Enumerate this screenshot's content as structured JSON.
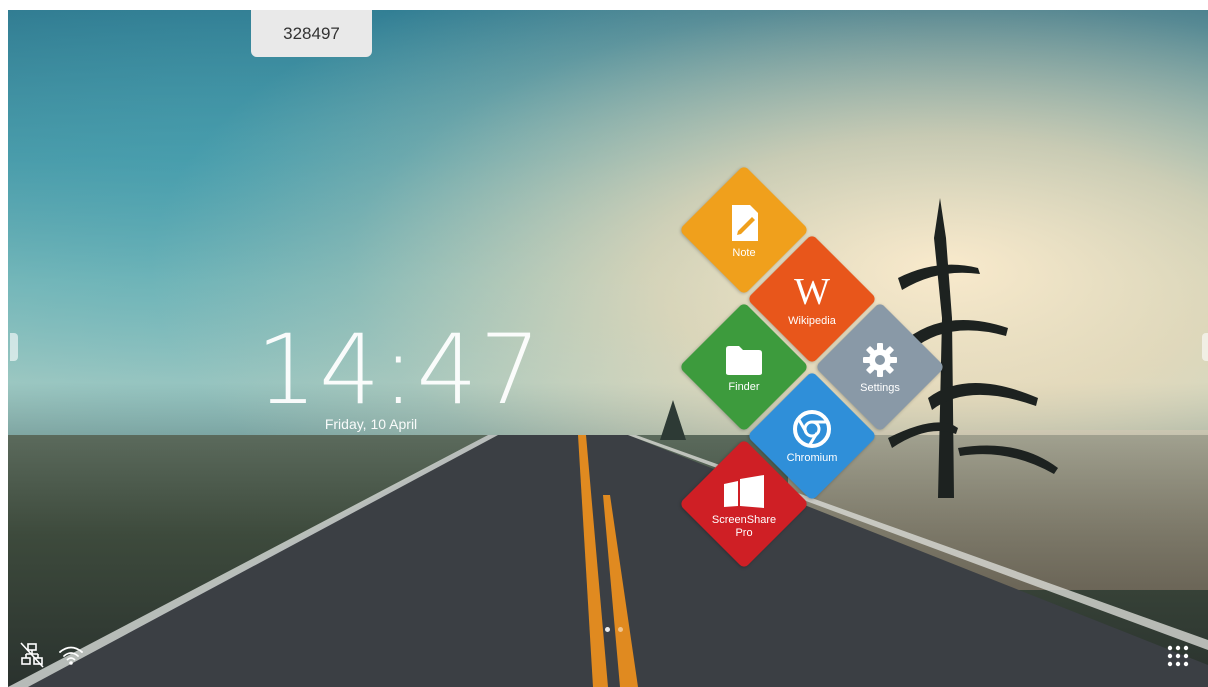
{
  "pin_code": "328497",
  "clock": {
    "time": "14:47",
    "date": "Friday, 10 April"
  },
  "tiles": [
    {
      "id": "note",
      "label": "Note",
      "color": "#f0a01c"
    },
    {
      "id": "wikipedia",
      "label": "Wikipedia",
      "color": "#e8561b",
      "glyph": "W"
    },
    {
      "id": "finder",
      "label": "Finder",
      "color": "#3d9b3d"
    },
    {
      "id": "settings",
      "label": "Settings",
      "color": "#8999a7"
    },
    {
      "id": "chromium",
      "label": "Chromium",
      "color": "#2f8fd9"
    },
    {
      "id": "screenshare",
      "label": "ScreenShare\nPro",
      "color": "#cf1f25"
    }
  ],
  "page_indicator": {
    "count": 2,
    "active": 1
  },
  "icons": {
    "network": "network-disconnected-icon",
    "wifi": "wifi-icon",
    "apps": "app-grid-icon",
    "left_handle": "left-panel-handle-icon",
    "right_handle": "right-panel-handle-icon"
  }
}
